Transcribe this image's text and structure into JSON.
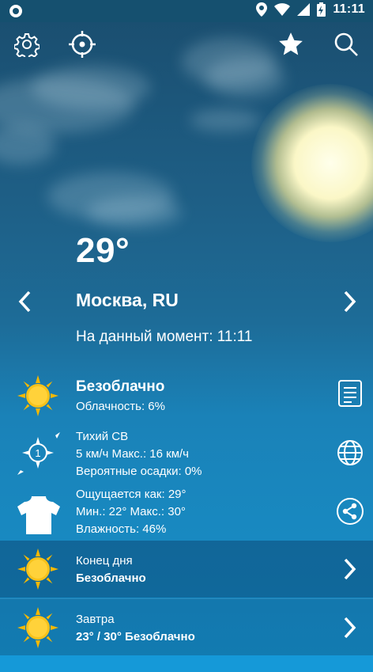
{
  "status_bar": {
    "time": "11:11"
  },
  "current": {
    "temperature": "29°",
    "city": "Москва, RU",
    "updated": "На данный момент: 11:11"
  },
  "condition": {
    "title": "Безоблачно",
    "cloudiness": "Облачность: 6%"
  },
  "wind": {
    "direction": "Тихий СВ",
    "speed": "5 км/ч Макс.: 16 км/ч",
    "wind_badge": "1",
    "precip": "Вероятные осадки: 0%"
  },
  "feels": {
    "feels_like": "Ощущается как: 29°",
    "minmax": "Мин.: 22° Макс.: 30°",
    "humidity": "Влажность: 46%"
  },
  "forecast": [
    {
      "label": "Конец дня",
      "summary": "Безоблачно"
    },
    {
      "label": "Завтра",
      "summary": "23° / 30° Безоблачно"
    }
  ],
  "icons": {
    "settings": "gear-icon",
    "locate": "crosshair-icon",
    "favorite": "star-icon",
    "search": "search-icon",
    "prev": "chevron-left-icon",
    "next": "chevron-right-icon",
    "sun": "sun-icon",
    "wind": "compass-icon",
    "tshirt": "tshirt-icon",
    "details": "document-icon",
    "globe": "globe-icon",
    "share": "share-icon"
  },
  "colors": {
    "sky_top": "#1a4d6e",
    "sky_bottom": "#1691cb",
    "status_bar": "#15506f",
    "sun": "#f5b800"
  }
}
